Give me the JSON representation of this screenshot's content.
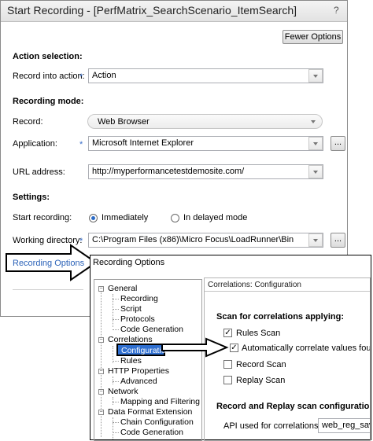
{
  "dialog": {
    "title": "Start Recording - [PerfMatrix_SearchScenario_ItemSearch]",
    "help": "?",
    "fewer_options": "Fewer Options",
    "action_selection": "Action selection:",
    "record_into_action_label": "Record into action:",
    "record_into_action_value": "Action",
    "recording_mode": "Recording mode:",
    "record_label": "Record:",
    "record_value": "Web Browser",
    "application_label": "Application:",
    "application_value": "Microsoft Internet Explorer",
    "url_label": "URL address:",
    "url_value": "http://myperformancetestdemosite.com/",
    "settings": "Settings:",
    "start_recording_label": "Start recording:",
    "immediately": "Immediately",
    "delayed": "In delayed mode",
    "working_dir_label": "Working directory:",
    "working_dir_value": "C:\\Program Files (x86)\\Micro Focus\\LoadRunner\\Bin",
    "recording_options_link": "Recording Options",
    "browse": "...",
    "required": "*"
  },
  "recording_options": {
    "title": "Recording Options",
    "tree": {
      "general": "General",
      "recording": "Recording",
      "script": "Script",
      "protocols": "Protocols",
      "code_generation": "Code Generation",
      "correlations": "Correlations",
      "configuration": "Configuration",
      "rules": "Rules",
      "http_properties": "HTTP Properties",
      "advanced": "Advanced",
      "network": "Network",
      "mapping_filtering": "Mapping and Filtering",
      "data_format_extension": "Data Format Extension",
      "chain_configuration": "Chain Configuration",
      "code_generation_2": "Code Generation"
    },
    "panel_title": "Correlations: Configuration",
    "scan_heading": "Scan for correlations applying:",
    "rules_scan": "Rules Scan",
    "auto_correlate": "Automatically correlate values found",
    "record_scan": "Record Scan",
    "replay_scan": "Replay Scan",
    "replay_config_heading": "Record and Replay scan configuration:",
    "api_label": "API used for correlations:",
    "api_value": "web_reg_save_"
  }
}
